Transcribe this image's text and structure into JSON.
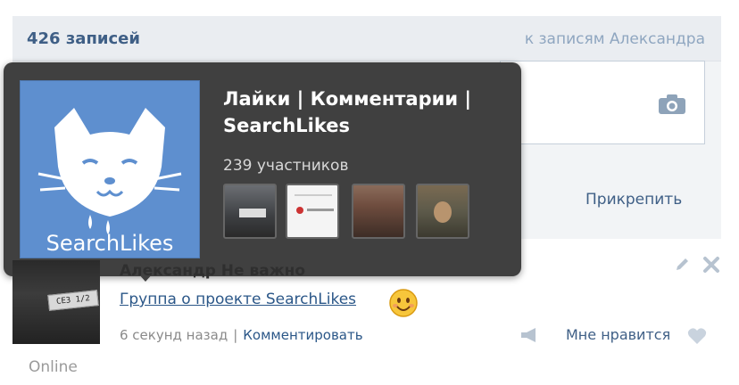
{
  "wall": {
    "count_label": "426 записей",
    "to_posts_link": "к записям Александра",
    "attach_label": "Прикрепить"
  },
  "popup": {
    "title": "Лайки | Комментарии | SearchLikes",
    "members": "239 участников",
    "avatar_text": "SearchLikes"
  },
  "post": {
    "author": "Александр Не важно",
    "text": "Группа о проекте SearchLikes",
    "time": "6 секунд назад",
    "comment_label": "Комментировать",
    "like_label": "Мне нравится",
    "avatar_plate": "СЕЗ 1/2"
  },
  "status": {
    "online": "Online"
  },
  "icons": {
    "camera": "camera-icon",
    "pencil": "pencil-icon",
    "close": "close-icon",
    "megaphone": "share-icon",
    "heart": "heart-icon",
    "smile": "smile-emoji-icon"
  },
  "colors": {
    "link": "#2b5788",
    "header_text": "#3f5f86",
    "popup_bg": "#404040",
    "avatar_bg": "#5e8fcf"
  }
}
